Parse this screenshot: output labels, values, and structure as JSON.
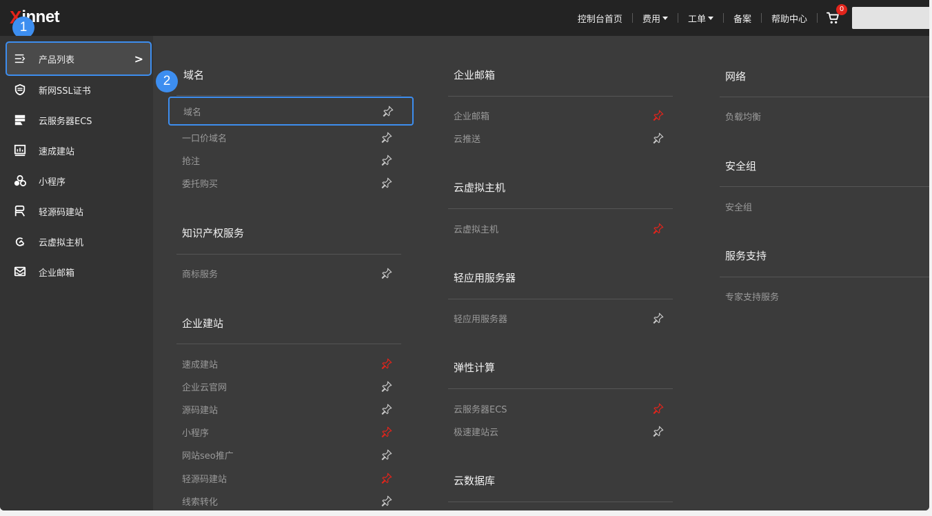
{
  "logo": {
    "accent": "X",
    "rest": "innet"
  },
  "step_markers": [
    "1",
    "2"
  ],
  "nav": {
    "items": [
      {
        "label": "控制台首页",
        "dropdown": false
      },
      {
        "label": "费用",
        "dropdown": true
      },
      {
        "label": "工单",
        "dropdown": true
      },
      {
        "label": "备案",
        "dropdown": false
      },
      {
        "label": "帮助中心",
        "dropdown": false
      }
    ],
    "cart_count": "0",
    "search_value": ""
  },
  "sidebar": {
    "items": [
      {
        "label": "产品列表",
        "icon": "menu-list-icon"
      },
      {
        "label": "新网SSL证书",
        "icon": "shield-icon"
      },
      {
        "label": "云服务器ECS",
        "icon": "server-icon"
      },
      {
        "label": "速成建站",
        "icon": "chart-board-icon"
      },
      {
        "label": "小程序",
        "icon": "mini-program-icon"
      },
      {
        "label": "轻源码建站",
        "icon": "source-code-icon"
      },
      {
        "label": "云虚拟主机",
        "icon": "virtual-host-icon"
      },
      {
        "label": "企业邮箱",
        "icon": "mail-icon"
      }
    ]
  },
  "columns": [
    {
      "sections": [
        {
          "title": "域名",
          "items": [
            {
              "label": "域名",
              "pinned": false
            },
            {
              "label": "一口价域名",
              "pinned": false
            },
            {
              "label": "抢注",
              "pinned": false
            },
            {
              "label": "委托购买",
              "pinned": false
            }
          ]
        },
        {
          "title": "知识产权服务",
          "items": [
            {
              "label": "商标服务",
              "pinned": false
            }
          ]
        },
        {
          "title": "企业建站",
          "items": [
            {
              "label": "速成建站",
              "pinned": true
            },
            {
              "label": "企业云官网",
              "pinned": false
            },
            {
              "label": "源码建站",
              "pinned": false
            },
            {
              "label": "小程序",
              "pinned": true
            },
            {
              "label": "网站seo推广",
              "pinned": false
            },
            {
              "label": "轻源码建站",
              "pinned": true
            },
            {
              "label": "线索转化",
              "pinned": false
            }
          ]
        }
      ]
    },
    {
      "sections": [
        {
          "title": "企业邮箱",
          "items": [
            {
              "label": "企业邮箱",
              "pinned": true
            },
            {
              "label": "云推送",
              "pinned": false
            }
          ]
        },
        {
          "title": "云虚拟主机",
          "items": [
            {
              "label": "云虚拟主机",
              "pinned": true
            }
          ]
        },
        {
          "title": "轻应用服务器",
          "items": [
            {
              "label": "轻应用服务器",
              "pinned": false
            }
          ]
        },
        {
          "title": "弹性计算",
          "items": [
            {
              "label": "云服务器ECS",
              "pinned": true
            },
            {
              "label": "极速建站云",
              "pinned": false
            }
          ]
        },
        {
          "title": "云数据库",
          "items": []
        }
      ]
    },
    {
      "sections": [
        {
          "title": "网络",
          "items": [
            {
              "label": "负载均衡",
              "pinned": false
            }
          ]
        },
        {
          "title": "安全组",
          "items": [
            {
              "label": "安全组",
              "pinned": false
            }
          ]
        },
        {
          "title": "服务支持",
          "items": [
            {
              "label": "专家支持服务",
              "pinned": false
            }
          ]
        }
      ]
    }
  ],
  "colors": {
    "accent_blue": "#3d8ef0",
    "pinned_red": "#e2241b",
    "unpinned_gray": "#c8c8c8"
  }
}
